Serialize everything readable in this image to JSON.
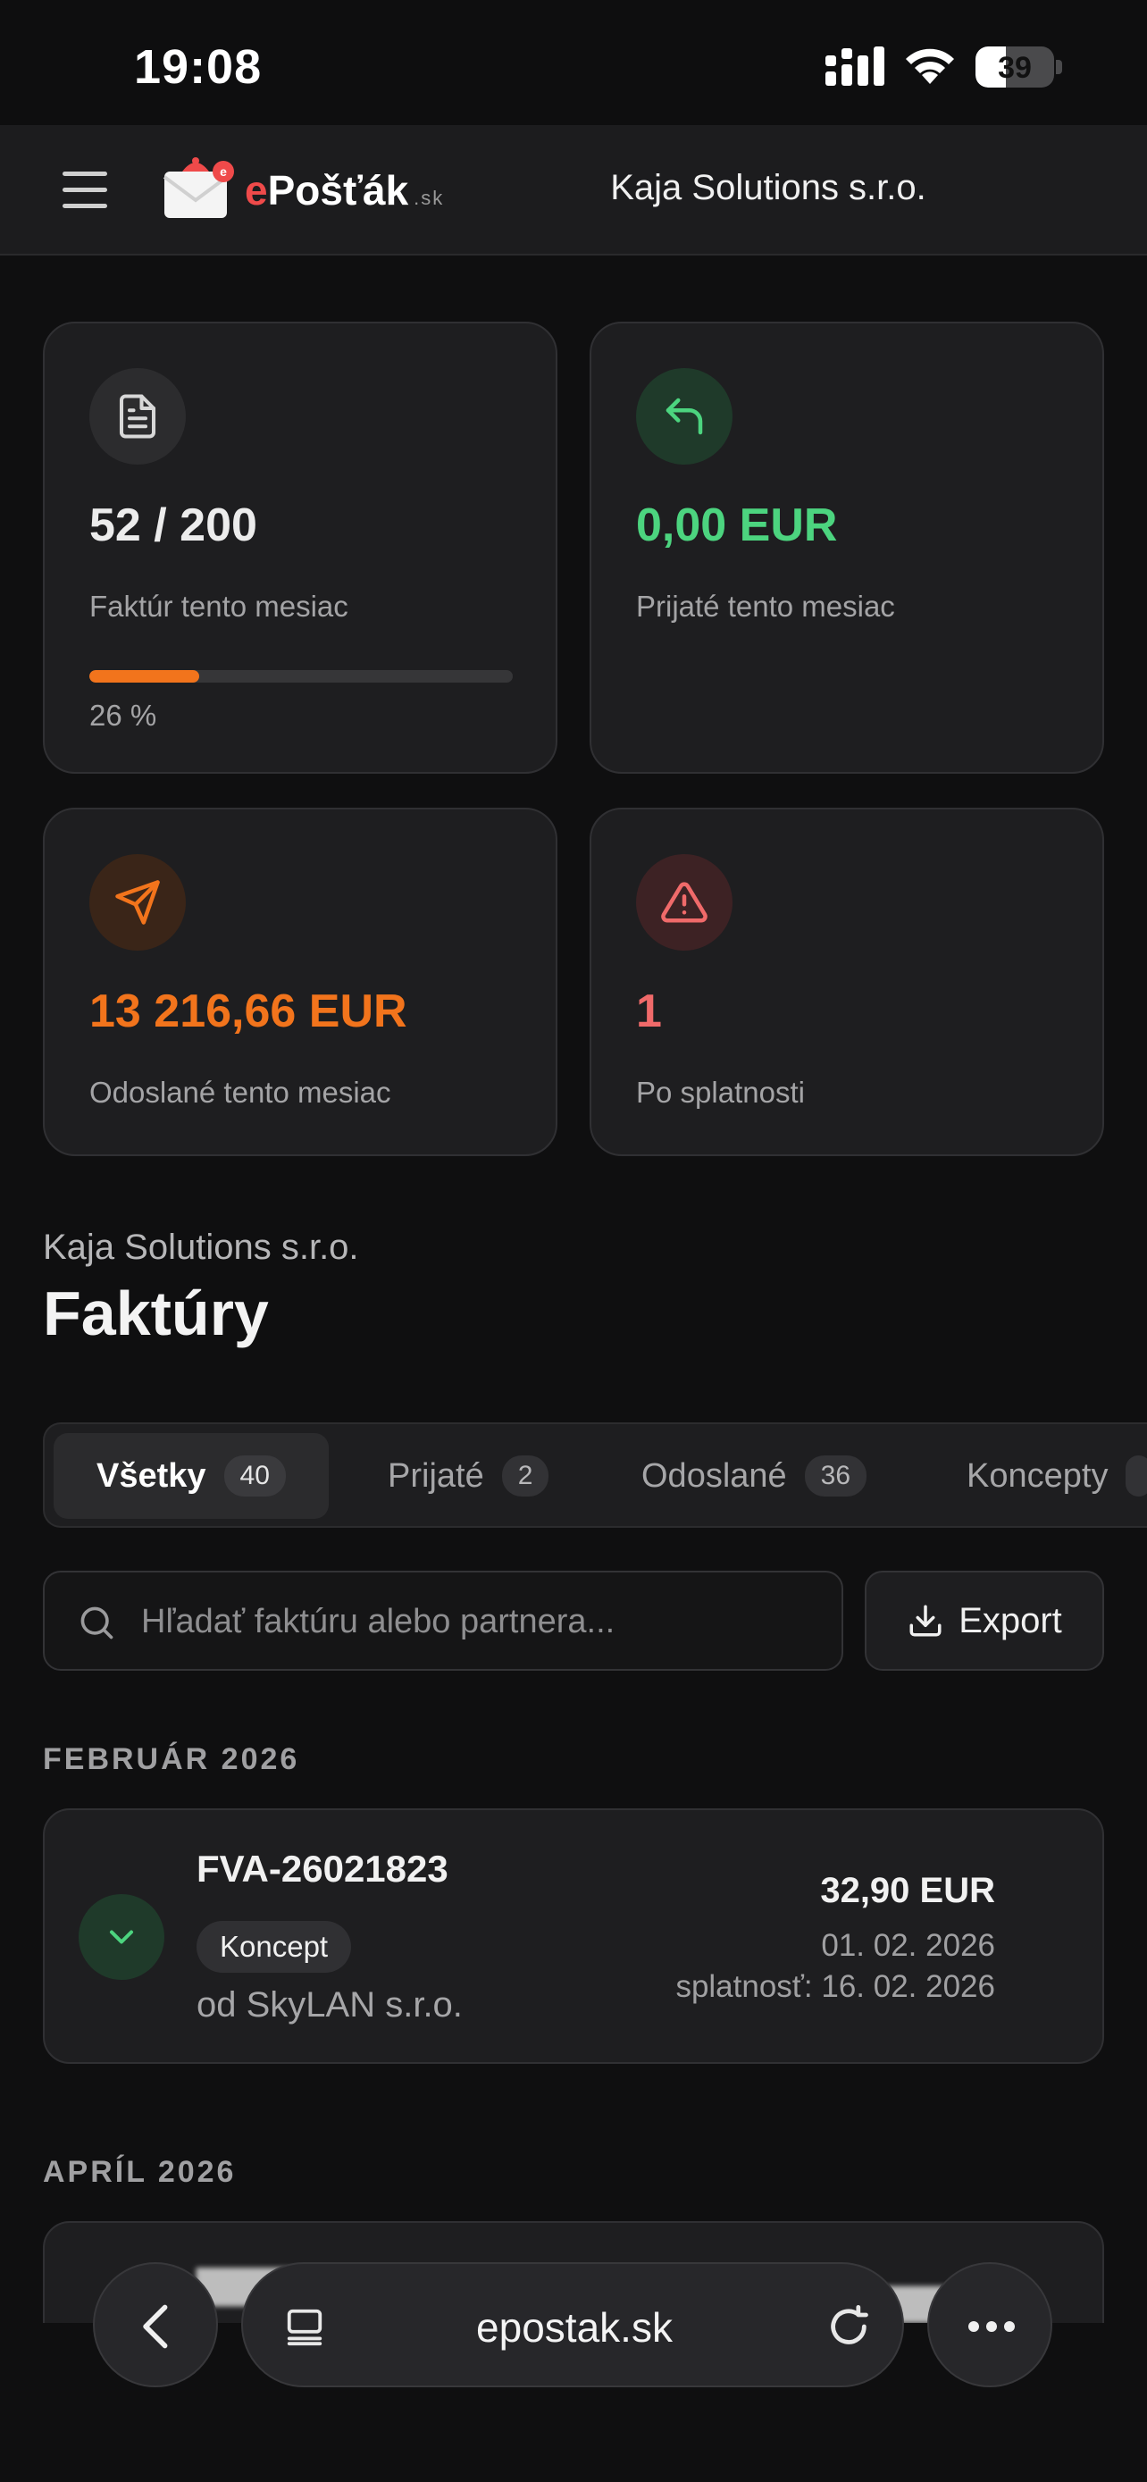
{
  "status_bar": {
    "time": "19:08",
    "battery": "39",
    "battery_level": 0.39
  },
  "header": {
    "logo": {
      "e": "e",
      "name": "Pošťák",
      "tld": ".sk"
    },
    "company": "Kaja Solutions s.r.o.",
    "icons": [
      "menu-icon",
      "envelope-logo-icon"
    ]
  },
  "stats": [
    {
      "value": "52 / 200",
      "label": "Faktúr tento mesiac",
      "progress_text": "26 %",
      "progress": 0.26,
      "color": "#ececec",
      "icon": "document-icon"
    },
    {
      "value": "0,00 EUR",
      "label": "Prijaté tento mesiac",
      "color": "#4cd47f",
      "icon": "reply-arrow-icon"
    },
    {
      "value": "13 216,66 EUR",
      "label": "Odoslané tento mesiac",
      "color": "#f2741c",
      "icon": "paper-plane-icon"
    },
    {
      "value": "1",
      "label": "Po splatnosti",
      "color": "#f06a6a",
      "icon": "warning-triangle-icon"
    }
  ],
  "section": {
    "company": "Kaja Solutions s.r.o.",
    "title": "Faktúry"
  },
  "tabs": [
    {
      "label": "Všetky",
      "count": "40",
      "active": true
    },
    {
      "label": "Prijaté",
      "count": "2"
    },
    {
      "label": "Odoslané",
      "count": "36"
    },
    {
      "label": "Koncepty"
    }
  ],
  "search": {
    "placeholder": "Hľadať faktúru alebo partnera...",
    "value": ""
  },
  "export": {
    "label": "Export"
  },
  "months": [
    "FEBRUÁR 2026",
    "APRÍL 2026"
  ],
  "invoices": [
    {
      "number": "FVA-26021823",
      "badge": "Koncept",
      "from": "od SkyLAN s.r.o.",
      "amount": "32,90 EUR",
      "date": "01. 02. 2026",
      "due": "splatnosť: 16. 02. 2026",
      "icon": "chevron-down-icon"
    }
  ],
  "browser": {
    "url": "epostak.sk"
  },
  "colors": {
    "accent_orange": "#f2741c",
    "success_green": "#4cd47f",
    "danger_red": "#f06a6a",
    "card_bg": "#1e1e20"
  }
}
